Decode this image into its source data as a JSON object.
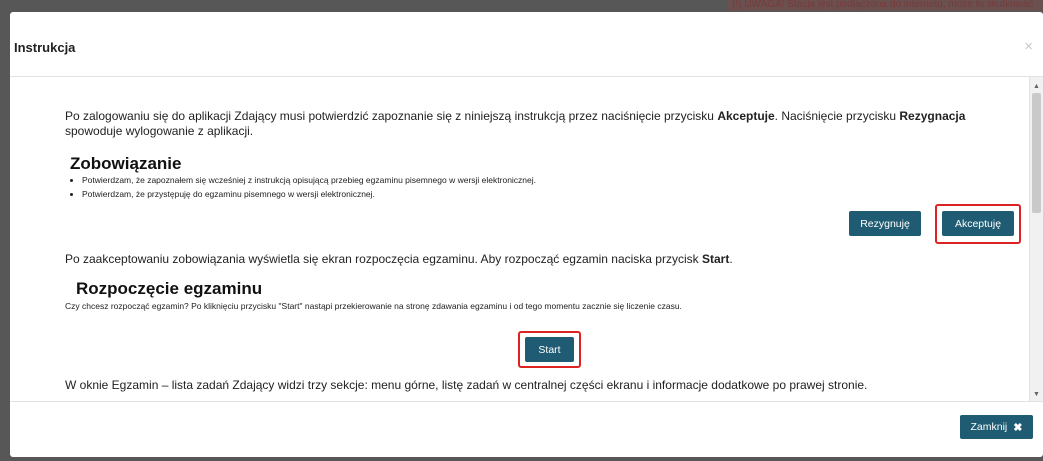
{
  "background": {
    "warning_text": "(!) UWAGA! Stacja jest podłączona do internetu, może to skutkować"
  },
  "modal": {
    "title": "Instrukcja",
    "close_symbol": "×",
    "scrollbar": {
      "up": "▲",
      "down": "▼",
      "grip": "≡"
    },
    "body": {
      "intro_pre": "Po zalogowaniu się do aplikacji Zdający musi potwierdzić zapoznanie się z niniejszą instrukcją przez naciśnięcie przycisku ",
      "intro_accept_bold": "Akceptuje",
      "intro_mid": ". Naciśnięcie przycisku ",
      "intro_resign_bold": "Rezygnacja",
      "intro_post": "spowoduje wylogowanie z aplikacji.",
      "commitment_heading": "Zobowiązanie",
      "commitment_items": [
        "Potwierdzam, że zapoznałem się wcześniej z instrukcją opisującą przebieg egzaminu pisemnego w wersji elektronicznej.",
        "Potwierdzam, że przystępuję do egzaminu pisemnego w wersji elektronicznej."
      ],
      "resign_button": "Rezygnuję",
      "accept_button": "Akceptuję",
      "after_accept_pre": "Po zaakceptowaniu zobowiązania wyświetla się ekran rozpoczęcia egzaminu. Aby rozpocząć egzamin naciska przycisk ",
      "after_accept_bold": "Start",
      "after_accept_post": ".",
      "start_heading": "Rozpoczęcie egzaminu",
      "start_text": "Czy chcesz rozpocząć egzamin? Po kliknięciu przycisku \"Start\" nastąpi przekierowanie na stronę zdawania egzaminu i od tego momentu zacznie się liczenie czasu.",
      "start_button": "Start",
      "window_text": "W oknie Egzamin – lista zadań Zdający widzi trzy sekcje: menu górne, listę zadań w centralnej części ekranu i informacje dodatkowe po prawej stronie."
    },
    "footer": {
      "close_button": "Zamknij",
      "close_icon": "✖"
    }
  },
  "colors": {
    "button": "#1f5c73",
    "highlight": "#dd2222"
  }
}
